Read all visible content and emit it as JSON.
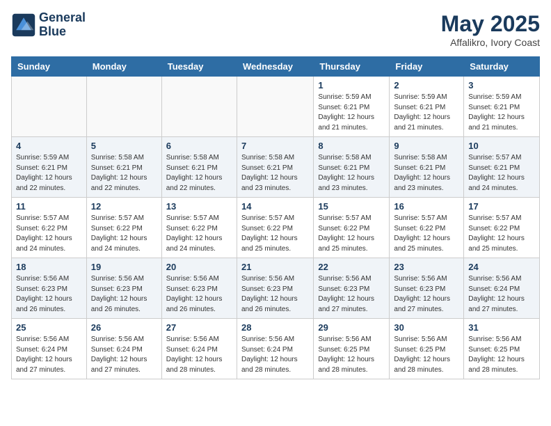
{
  "header": {
    "logo_line1": "General",
    "logo_line2": "Blue",
    "month": "May 2025",
    "location": "Affalikro, Ivory Coast"
  },
  "weekdays": [
    "Sunday",
    "Monday",
    "Tuesday",
    "Wednesday",
    "Thursday",
    "Friday",
    "Saturday"
  ],
  "weeks": [
    [
      {
        "day": "",
        "info": ""
      },
      {
        "day": "",
        "info": ""
      },
      {
        "day": "",
        "info": ""
      },
      {
        "day": "",
        "info": ""
      },
      {
        "day": "1",
        "info": "Sunrise: 5:59 AM\nSunset: 6:21 PM\nDaylight: 12 hours\nand 21 minutes."
      },
      {
        "day": "2",
        "info": "Sunrise: 5:59 AM\nSunset: 6:21 PM\nDaylight: 12 hours\nand 21 minutes."
      },
      {
        "day": "3",
        "info": "Sunrise: 5:59 AM\nSunset: 6:21 PM\nDaylight: 12 hours\nand 21 minutes."
      }
    ],
    [
      {
        "day": "4",
        "info": "Sunrise: 5:59 AM\nSunset: 6:21 PM\nDaylight: 12 hours\nand 22 minutes."
      },
      {
        "day": "5",
        "info": "Sunrise: 5:58 AM\nSunset: 6:21 PM\nDaylight: 12 hours\nand 22 minutes."
      },
      {
        "day": "6",
        "info": "Sunrise: 5:58 AM\nSunset: 6:21 PM\nDaylight: 12 hours\nand 22 minutes."
      },
      {
        "day": "7",
        "info": "Sunrise: 5:58 AM\nSunset: 6:21 PM\nDaylight: 12 hours\nand 23 minutes."
      },
      {
        "day": "8",
        "info": "Sunrise: 5:58 AM\nSunset: 6:21 PM\nDaylight: 12 hours\nand 23 minutes."
      },
      {
        "day": "9",
        "info": "Sunrise: 5:58 AM\nSunset: 6:21 PM\nDaylight: 12 hours\nand 23 minutes."
      },
      {
        "day": "10",
        "info": "Sunrise: 5:57 AM\nSunset: 6:21 PM\nDaylight: 12 hours\nand 24 minutes."
      }
    ],
    [
      {
        "day": "11",
        "info": "Sunrise: 5:57 AM\nSunset: 6:22 PM\nDaylight: 12 hours\nand 24 minutes."
      },
      {
        "day": "12",
        "info": "Sunrise: 5:57 AM\nSunset: 6:22 PM\nDaylight: 12 hours\nand 24 minutes."
      },
      {
        "day": "13",
        "info": "Sunrise: 5:57 AM\nSunset: 6:22 PM\nDaylight: 12 hours\nand 24 minutes."
      },
      {
        "day": "14",
        "info": "Sunrise: 5:57 AM\nSunset: 6:22 PM\nDaylight: 12 hours\nand 25 minutes."
      },
      {
        "day": "15",
        "info": "Sunrise: 5:57 AM\nSunset: 6:22 PM\nDaylight: 12 hours\nand 25 minutes."
      },
      {
        "day": "16",
        "info": "Sunrise: 5:57 AM\nSunset: 6:22 PM\nDaylight: 12 hours\nand 25 minutes."
      },
      {
        "day": "17",
        "info": "Sunrise: 5:57 AM\nSunset: 6:22 PM\nDaylight: 12 hours\nand 25 minutes."
      }
    ],
    [
      {
        "day": "18",
        "info": "Sunrise: 5:56 AM\nSunset: 6:23 PM\nDaylight: 12 hours\nand 26 minutes."
      },
      {
        "day": "19",
        "info": "Sunrise: 5:56 AM\nSunset: 6:23 PM\nDaylight: 12 hours\nand 26 minutes."
      },
      {
        "day": "20",
        "info": "Sunrise: 5:56 AM\nSunset: 6:23 PM\nDaylight: 12 hours\nand 26 minutes."
      },
      {
        "day": "21",
        "info": "Sunrise: 5:56 AM\nSunset: 6:23 PM\nDaylight: 12 hours\nand 26 minutes."
      },
      {
        "day": "22",
        "info": "Sunrise: 5:56 AM\nSunset: 6:23 PM\nDaylight: 12 hours\nand 27 minutes."
      },
      {
        "day": "23",
        "info": "Sunrise: 5:56 AM\nSunset: 6:23 PM\nDaylight: 12 hours\nand 27 minutes."
      },
      {
        "day": "24",
        "info": "Sunrise: 5:56 AM\nSunset: 6:24 PM\nDaylight: 12 hours\nand 27 minutes."
      }
    ],
    [
      {
        "day": "25",
        "info": "Sunrise: 5:56 AM\nSunset: 6:24 PM\nDaylight: 12 hours\nand 27 minutes."
      },
      {
        "day": "26",
        "info": "Sunrise: 5:56 AM\nSunset: 6:24 PM\nDaylight: 12 hours\nand 27 minutes."
      },
      {
        "day": "27",
        "info": "Sunrise: 5:56 AM\nSunset: 6:24 PM\nDaylight: 12 hours\nand 28 minutes."
      },
      {
        "day": "28",
        "info": "Sunrise: 5:56 AM\nSunset: 6:24 PM\nDaylight: 12 hours\nand 28 minutes."
      },
      {
        "day": "29",
        "info": "Sunrise: 5:56 AM\nSunset: 6:25 PM\nDaylight: 12 hours\nand 28 minutes."
      },
      {
        "day": "30",
        "info": "Sunrise: 5:56 AM\nSunset: 6:25 PM\nDaylight: 12 hours\nand 28 minutes."
      },
      {
        "day": "31",
        "info": "Sunrise: 5:56 AM\nSunset: 6:25 PM\nDaylight: 12 hours\nand 28 minutes."
      }
    ]
  ]
}
